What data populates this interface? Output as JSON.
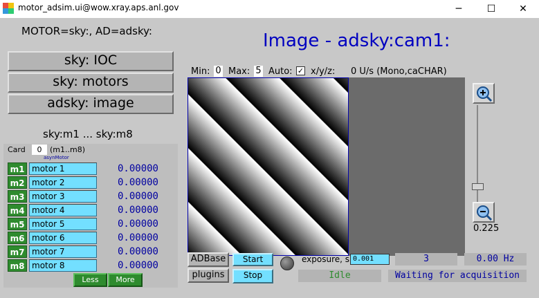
{
  "window": {
    "title": "motor_adsim.ui@wow.xray.aps.anl.gov",
    "minimize": "─",
    "maximize": "☐",
    "close": "✕"
  },
  "header": {
    "motor_ad": "MOTOR=sky:, AD=adsky:",
    "image_title": "Image - adsky:cam1:"
  },
  "nav": {
    "ioc": "sky: IOC",
    "motors": "sky: motors",
    "image": "adsky: image"
  },
  "motors": {
    "range_title": "sky:m1 ... sky:m8",
    "card_label": "Card",
    "card_value": "0",
    "card_range": "(m1..m8)",
    "sub_label": "asynMotor",
    "rows": [
      {
        "id": "m1",
        "name": "motor 1",
        "value": "0.00000"
      },
      {
        "id": "m2",
        "name": "motor 2",
        "value": "0.00000"
      },
      {
        "id": "m3",
        "name": "motor 3",
        "value": "0.00000"
      },
      {
        "id": "m4",
        "name": "motor 4",
        "value": "0.00000"
      },
      {
        "id": "m5",
        "name": "motor 5",
        "value": "0.00000"
      },
      {
        "id": "m6",
        "name": "motor 6",
        "value": "0.00000"
      },
      {
        "id": "m7",
        "name": "motor 7",
        "value": "0.00000"
      },
      {
        "id": "m8",
        "name": "motor 8",
        "value": "0.00000"
      }
    ],
    "less": "Less",
    "more": "More"
  },
  "image_controls": {
    "min_label": "Min:",
    "min_value": "0",
    "max_label": "Max:",
    "max_value": "5",
    "auto_label": "Auto:",
    "auto_checked": true,
    "xyz_label": "x/y/z:",
    "rate_info": "0 U/s (Mono,caCHAR)",
    "zoom_value": "0.225",
    "zoom_level_fraction": 0.9
  },
  "acquisition": {
    "adbase": "ADBase",
    "plugins": "plugins",
    "start": "Start",
    "stop": "Stop",
    "exposure_label": "exposure, s",
    "exposure_value": "0.001",
    "count": "3",
    "rate": "0.00 Hz",
    "state": "Idle",
    "status": "Waiting for acquisition"
  },
  "colors": {
    "title_blue": "#0000c0",
    "status_green": "#2e8b2e",
    "value_blue": "#0000a0",
    "cyan": "#73dfff"
  }
}
